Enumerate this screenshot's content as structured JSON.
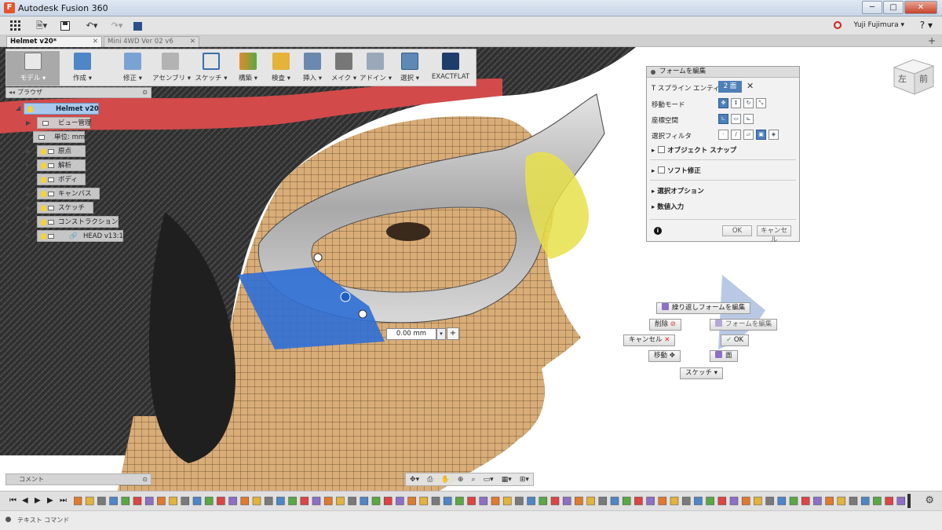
{
  "window": {
    "title": "Autodesk Fusion 360",
    "buttons": [
      "─",
      "□",
      "✕"
    ]
  },
  "qat": {
    "user": "Yuji Fujimura ▾",
    "help": "? ▾"
  },
  "tabs": [
    {
      "label": "Helmet v20*",
      "active": true
    },
    {
      "label": "Mini 4WD Ver 02 v6",
      "active": false
    }
  ],
  "ribbon": [
    {
      "label": "モデル ▾",
      "icon": "model-cube-icon"
    },
    {
      "label": "作成 ▾",
      "icon": "create-box-icon"
    },
    {
      "label": "修正 ▾",
      "icon": "modify-icon"
    },
    {
      "label": "アセンブリ ▾",
      "icon": "assemble-icon"
    },
    {
      "label": "スケッチ ▾",
      "icon": "sketch-icon"
    },
    {
      "label": "構築 ▾",
      "icon": "construct-icon"
    },
    {
      "label": "検査 ▾",
      "icon": "inspect-icon"
    },
    {
      "label": "挿入 ▾",
      "icon": "insert-image-icon"
    },
    {
      "label": "メイク ▾",
      "icon": "make-icon"
    },
    {
      "label": "アドイン ▾",
      "icon": "addin-icon"
    },
    {
      "label": "選択 ▾",
      "icon": "select-icon"
    },
    {
      "label": "EXACTFLAT",
      "icon": "exactflat-icon"
    }
  ],
  "browser": {
    "title": "ブラウザ",
    "root": "Helmet v20",
    "items": [
      "ビュー管理",
      "単位: mm",
      "原点",
      "解析",
      "ボディ",
      "キャンバス",
      "スケッチ",
      "コンストラクション",
      "HEAD v13:1"
    ]
  },
  "form": {
    "title": "フォームを編集",
    "row1": {
      "label": "T スプライン エンティティ",
      "value": "2 面"
    },
    "row2": "移動モード",
    "row3": "座標空間",
    "row4": "選択フィルタ",
    "sections": [
      "オブジェクト スナップ",
      "ソフト修正",
      "選択オプション",
      "数値入力"
    ],
    "ok": "OK",
    "cancel": "キャンセル"
  },
  "distance": {
    "value": "0.00 mm"
  },
  "marking_menu": {
    "repeat": "繰り返しフォームを編集",
    "delete": "削除",
    "edit_form": "フォームを編集",
    "cancel": "キャンセル",
    "ok": "OK",
    "move": "移動",
    "face": "面",
    "sketch": "スケッチ ▾"
  },
  "viewcube": {
    "left": "左",
    "front": "前"
  },
  "comment": {
    "label": "コメント"
  },
  "status": {
    "label": "テキスト コマンド"
  },
  "colors": {
    "accent": "#4d7fb8",
    "skin": "#d9ad78",
    "helmet": "#2c2c2c",
    "visor_red": "#d24a4a",
    "selection_blue": "#2f6fd6"
  }
}
